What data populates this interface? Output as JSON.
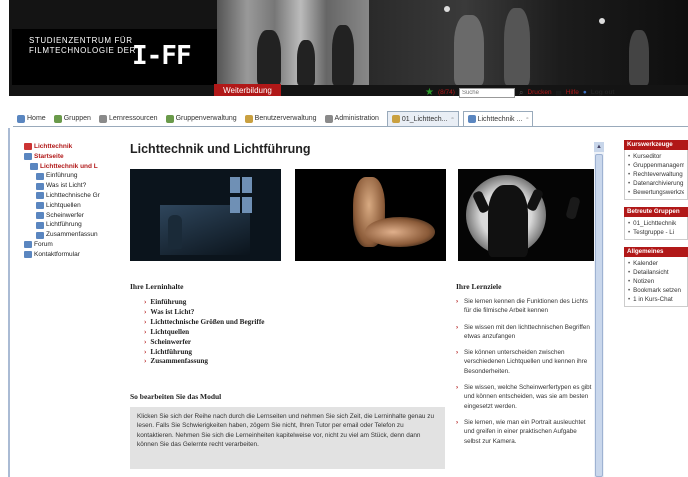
{
  "banner": {
    "logo_line1": "STUDIENZENTRUM FÜR",
    "logo_line2": "FILMTECHNOLOGIE DER",
    "logo_mark": "I-FF",
    "weiterbildung_label": "Weiterbildung"
  },
  "toolbar": {
    "counter": "(8/74)",
    "search_placeholder": "Suche",
    "drucken_label": "Drucken",
    "hilfe_label": "Hilfe",
    "logout_label": "Log out"
  },
  "tabs": [
    {
      "label": "Home"
    },
    {
      "label": "Gruppen"
    },
    {
      "label": "Lernressourcen"
    },
    {
      "label": "Gruppenverwaltung"
    },
    {
      "label": "Benutzerverwaltung"
    },
    {
      "label": "Administration"
    },
    {
      "label": "01_Lichttech..."
    },
    {
      "label": "Lichttechnik ..."
    }
  ],
  "tree": {
    "root": "Lichttechnik",
    "start": "Startseite",
    "course": "Lichttechnik und L",
    "pages": [
      "Einführung",
      "Was ist Licht?",
      "Lichttechnische Gr",
      "Lichtquellen",
      "Scheinwerfer",
      "Lichtführung",
      "Zusammenfassun"
    ],
    "forum": "Forum",
    "kontakt": "Kontaktformular"
  },
  "main": {
    "title": "Lichttechnik und Lichtführung",
    "lerninhalte_heading": "Ihre Lerninhalte",
    "lerninhalte": [
      "Einführung",
      "Was ist Licht?",
      "Lichttechnische Größen und Begriffe",
      "Lichtquellen",
      "Scheinwerfer",
      "Lichtführung",
      "Zusammenfassung"
    ],
    "bearbeiten_heading": "So bearbeiten Sie das Modul",
    "bearbeiten_text": "Klicken Sie sich der Reihe nach durch die Lernseiten und nehmen Sie sich Zeit, die Lerninhalte genau zu lesen. Falls Sie Schwierigkeiten haben, zögern Sie nicht, Ihren Tutor per email oder Telefon zu kontaktieren. Nehmen Sie sich die Lerneinheiten kapitelweise vor, nicht zu viel am Stück, denn dann können Sie das Gelernte recht verarbeiten.",
    "lernziele_heading": "Ihre Lernziele",
    "lernziele": [
      "Sie lernen kennen die Funktionen des Lichts für die filmische Arbeit kennen",
      "Sie wissen mit den lichttechnischen Begriffen etwas anzufangen",
      "Sie können unterscheiden zwischen verschiedenen Lichtquellen und kennen ihre Besonderheiten.",
      "Sie wissen, welche Scheinwerfertypen es gibt und können entscheiden, was sie am besten eingesetzt werden.",
      "Sie lernen, wie man ein Portrait ausleuchtet und greifen in einer praktischen Aufgabe selbst zur Kamera."
    ]
  },
  "sidebar": {
    "kurswerkzeuge_heading": "Kurswerkzeuge",
    "kurswerkzeuge": [
      "Kurseditor",
      "Gruppenmanagement",
      "Rechteverwaltung",
      "Datenarchivierung",
      "Bewertungswerkzeug"
    ],
    "gruppen_heading": "Betreute Gruppen",
    "gruppen": [
      "01_Lichttechnik",
      "Testgruppe - Li"
    ],
    "allgemeines_heading": "Allgemeines",
    "allgemeines": [
      "Kalender",
      "Detailansicht",
      "Notizen",
      "Bookmark setzen",
      "1 in Kurs-Chat"
    ]
  },
  "colors": {
    "accent_red": "#b11818",
    "link_blue": "#5a86c0"
  }
}
